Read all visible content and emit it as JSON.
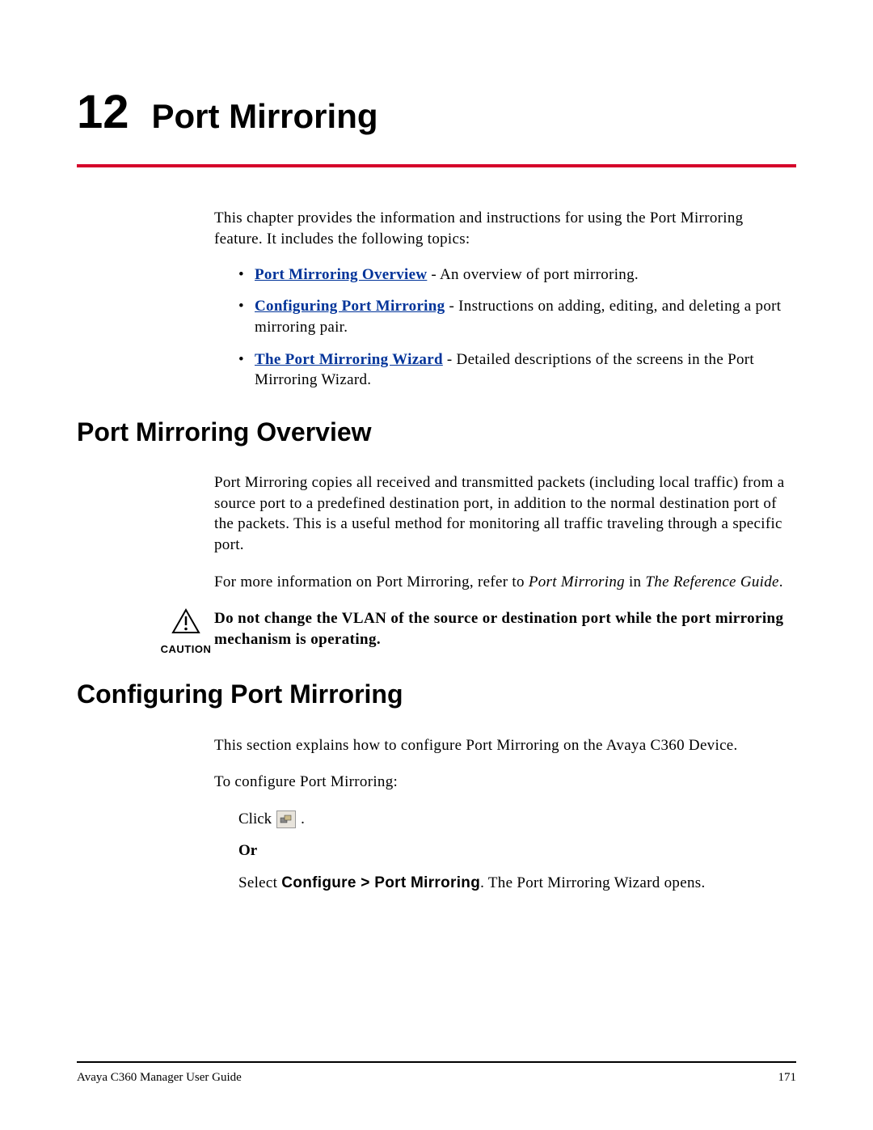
{
  "chapter": {
    "number": "12",
    "title": "Port Mirroring"
  },
  "intro": "This chapter provides the information and instructions for using the Port Mirroring feature. It includes the following topics:",
  "topics": [
    {
      "link": "Port Mirroring Overview",
      "desc": " - An overview of port mirroring."
    },
    {
      "link": "Configuring Port Mirroring",
      "desc": " - Instructions on adding, editing, and deleting a port mirroring pair."
    },
    {
      "link": "The Port Mirroring Wizard",
      "desc": " - Detailed descriptions of the screens in the Port Mirroring Wizard."
    }
  ],
  "section1": {
    "heading": "Port Mirroring Overview",
    "para1": "Port Mirroring copies all received and transmitted packets (including local traffic) from a source port to a predefined destination port, in addition to the normal destination port of the packets. This is a useful method for monitoring all traffic traveling through a specific port.",
    "para2_pre": "For more information on Port Mirroring, refer to ",
    "para2_it1": "Port Mirroring",
    "para2_mid": " in ",
    "para2_it2": "The Reference Guide",
    "para2_end": "."
  },
  "caution": {
    "label": "CAUTION",
    "text": "Do not change the VLAN of the source or destination port while the port mirroring mechanism is operating."
  },
  "section2": {
    "heading": "Configuring Port Mirroring",
    "para1": "This section explains how to configure Port Mirroring on the Avaya C360 Device.",
    "para2": "To configure Port Mirroring:",
    "click_label": "Click ",
    "click_end": " .",
    "or_label": "Or",
    "select_pre": "Select ",
    "select_menu": "Configure > Port Mirroring",
    "select_post": ". The Port Mirroring Wizard opens."
  },
  "footer": {
    "left": "Avaya C360 Manager User Guide",
    "right": "171"
  }
}
